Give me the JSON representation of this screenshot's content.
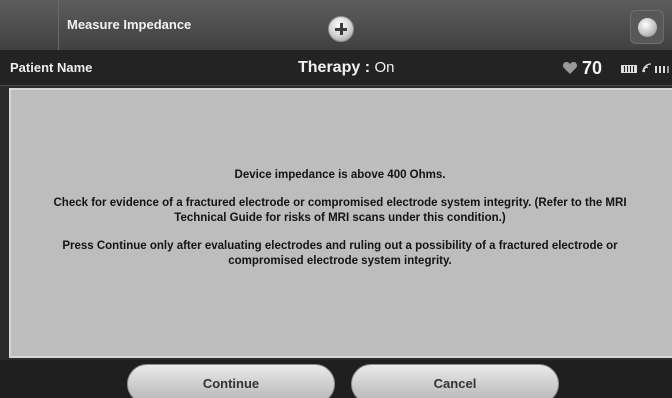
{
  "header": {
    "screen_title": "Measure Impedance",
    "add_icon": "plus-circle-icon",
    "corner_icon": "round-knob-icon"
  },
  "status_bar": {
    "patient_name": "Patient Name",
    "therapy_label": "Therapy :",
    "therapy_value": "On",
    "heart_rate": "70",
    "icons": [
      "heart-icon",
      "battery-icon",
      "wifi-icon",
      "signal-bars-icon"
    ]
  },
  "dialog": {
    "message_lines": [
      "Device impedance is above 400 Ohms.",
      "Check for evidence of a fractured electrode or compromised electrode system integrity. (Refer to the MRI Technical Guide for risks of MRI scans under this condition.)",
      "Press Continue only after evaluating electrodes and ruling out a possibility of a fractured electrode or compromised electrode system integrity."
    ]
  },
  "buttons": {
    "continue_label": "Continue",
    "cancel_label": "Cancel"
  },
  "colors": {
    "dialog_background": "#bdbdbd",
    "header_background": "#4a4a4a",
    "status_bar_background": "#232323"
  }
}
